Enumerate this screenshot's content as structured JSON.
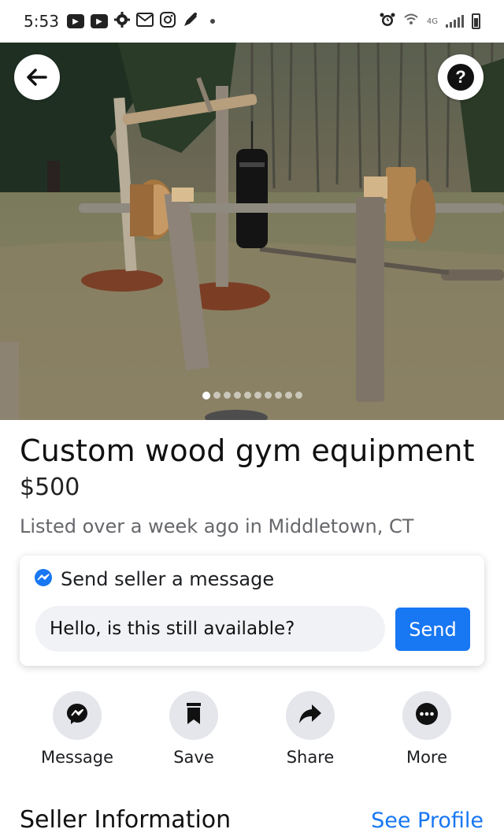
{
  "status_bar": {
    "time": "5:53",
    "network_label": "4G",
    "left_icons": [
      "youtube-icon",
      "youtube-icon",
      "settings-icon",
      "gmail-icon",
      "instagram-icon",
      "pen-icon"
    ],
    "right_icons": [
      "alarm-icon",
      "wifi-icon",
      "signal-icon",
      "battery-icon"
    ]
  },
  "hero": {
    "image_count": 10,
    "active_index": 0,
    "back_icon": "arrow-left-icon",
    "help_icon": "question-icon",
    "help_label": "?"
  },
  "listing": {
    "title": "Custom wood gym equipment",
    "price": "$500",
    "listed": "Listed over a week ago in Middletown, CT"
  },
  "message_card": {
    "header": "Send seller a message",
    "input_value": "Hello, is this still available?",
    "send_label": "Send"
  },
  "actions": [
    {
      "label": "Message",
      "icon": "messenger-icon"
    },
    {
      "label": "Save",
      "icon": "bookmark-icon"
    },
    {
      "label": "Share",
      "icon": "share-arrow-icon"
    },
    {
      "label": "More",
      "icon": "more-dots-icon"
    }
  ],
  "seller": {
    "title": "Seller Information",
    "link": "See Profile"
  },
  "colors": {
    "accent": "#1877f2",
    "secondary_text": "#65676b",
    "action_circle": "#e4e6eb",
    "input_bg": "#f0f2f5"
  }
}
